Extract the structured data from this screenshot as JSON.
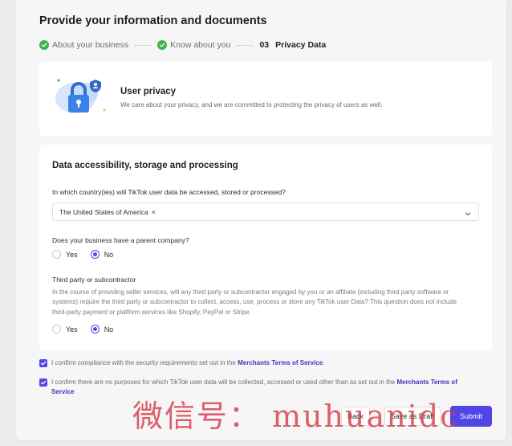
{
  "page": {
    "title": "Provide your information and documents"
  },
  "steps": [
    {
      "label": "About your business",
      "status": "done"
    },
    {
      "label": "Know about you",
      "status": "done"
    },
    {
      "number": "03",
      "label": "Privacy Data",
      "status": "current"
    }
  ],
  "privacy": {
    "title": "User privacy",
    "description": "We care about your privacy, and we are committed to protecting the privacy of users as well."
  },
  "data_section": {
    "title": "Data accessibility, storage and processing",
    "q1_label": "In which country(ies) will TikTok user data be accessed, stored or processed?",
    "q1_selected": "The United States of America",
    "q1_remove": "×",
    "q2_label": "Does your business have a parent company?",
    "q2_options": [
      "Yes",
      "No"
    ],
    "q2_selected": "No",
    "q3_label": "Third party or subcontractor",
    "q3_description": "In the course of providing seller services, will any third party or subcontractor engaged by you or an affiliate (including third party software or systems) require the third party or subcontractor to collect, access, use, process or store any TikTok user Data? This question does not include third-party payment or platform services like Shopify, PayPal or Stripe.",
    "q3_options": [
      "Yes",
      "No"
    ],
    "q3_selected": "No"
  },
  "confirmations": [
    {
      "checked": true,
      "text": "I confirm compliance with the security requirements set out in the ",
      "link": "Merchants Terms of Service",
      "suffix": "."
    },
    {
      "checked": true,
      "text": "I confirm there are no purposes for which TikTok user data will be collected, accessed or used other than as set out in the ",
      "link": "Merchants Terms of Service",
      "suffix": ""
    }
  ],
  "actions": {
    "back": "Back",
    "save_draft": "Save as Draft",
    "submit": "Submit"
  },
  "watermark": "微信号： muhuanidc",
  "colors": {
    "accent": "#5046e5",
    "success": "#3fb34f",
    "link": "#3d35b8"
  }
}
